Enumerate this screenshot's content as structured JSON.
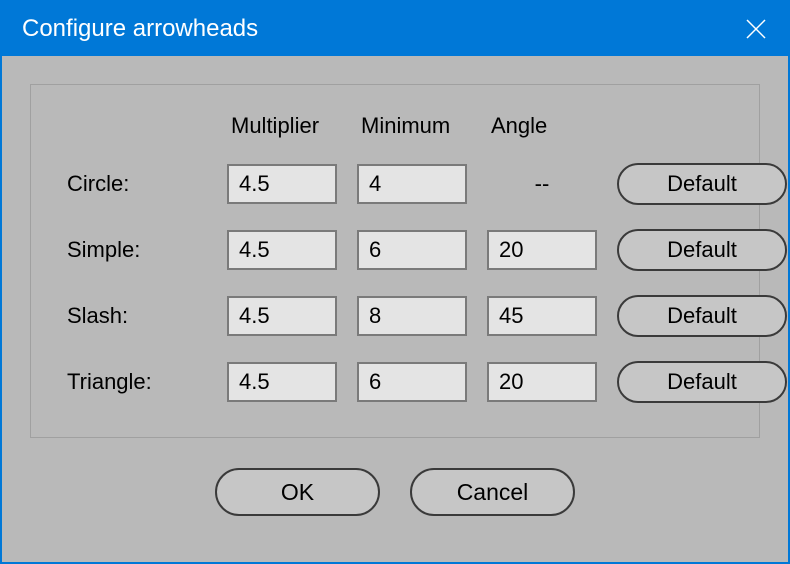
{
  "title": "Configure arrowheads",
  "headers": {
    "multiplier": "Multiplier",
    "minimum": "Minimum",
    "angle": "Angle"
  },
  "rows": {
    "circle": {
      "label": "Circle:",
      "multiplier": "4.5",
      "minimum": "4",
      "angle_placeholder": "--",
      "default_label": "Default"
    },
    "simple": {
      "label": "Simple:",
      "multiplier": "4.5",
      "minimum": "6",
      "angle": "20",
      "default_label": "Default"
    },
    "slash": {
      "label": "Slash:",
      "multiplier": "4.5",
      "minimum": "8",
      "angle": "45",
      "default_label": "Default"
    },
    "triangle": {
      "label": "Triangle:",
      "multiplier": "4.5",
      "minimum": "6",
      "angle": "20",
      "default_label": "Default"
    }
  },
  "buttons": {
    "ok": "OK",
    "cancel": "Cancel"
  }
}
